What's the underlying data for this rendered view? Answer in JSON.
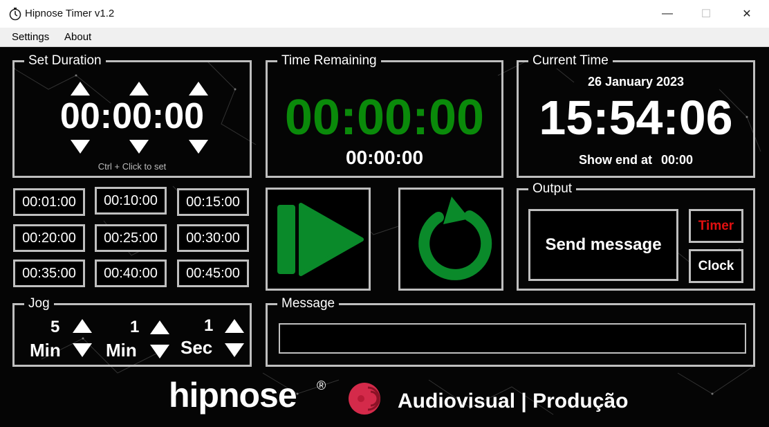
{
  "window": {
    "title": "Hipnose Timer v1.2",
    "minimize_glyph": "—",
    "maximize_glyph": "☐",
    "close_glyph": "✕"
  },
  "menu": {
    "items": [
      "Settings",
      "About"
    ]
  },
  "set_duration": {
    "title": "Set Duration",
    "time": "00:00:00",
    "hint": "Ctrl + Click to set"
  },
  "presets": [
    "00:01:00",
    "00:10:00",
    "00:15:00",
    "00:20:00",
    "00:25:00",
    "00:30:00",
    "00:35:00",
    "00:40:00",
    "00:45:00"
  ],
  "jog": {
    "title": "Jog",
    "groups": [
      {
        "amount": "5",
        "unit": "Min"
      },
      {
        "amount": "1",
        "unit": "Min"
      },
      {
        "amount": "1",
        "unit": "Sec"
      }
    ]
  },
  "time_remaining": {
    "title": "Time Remaining",
    "main": "00:00:00",
    "sub": "00:00:00",
    "color": "#0a8a0a"
  },
  "current_time": {
    "title": "Current Time",
    "date": "26 January 2023",
    "time": "15:54:06",
    "show_end_label": "Show end at",
    "show_end_value": "00:00"
  },
  "controls": {
    "play_icon": "play-icon",
    "reset_icon": "reset-icon",
    "accent": "#0a8a2a"
  },
  "output": {
    "title": "Output",
    "send_label": "Send message",
    "timer_label": "Timer",
    "timer_color": "#e01010",
    "clock_label": "Clock"
  },
  "message": {
    "title": "Message",
    "value": ""
  },
  "footer": {
    "brand": "hipnose",
    "registered": "®",
    "tagline": "Audiovisual | Produção",
    "logo_color": "#d42a4a"
  }
}
